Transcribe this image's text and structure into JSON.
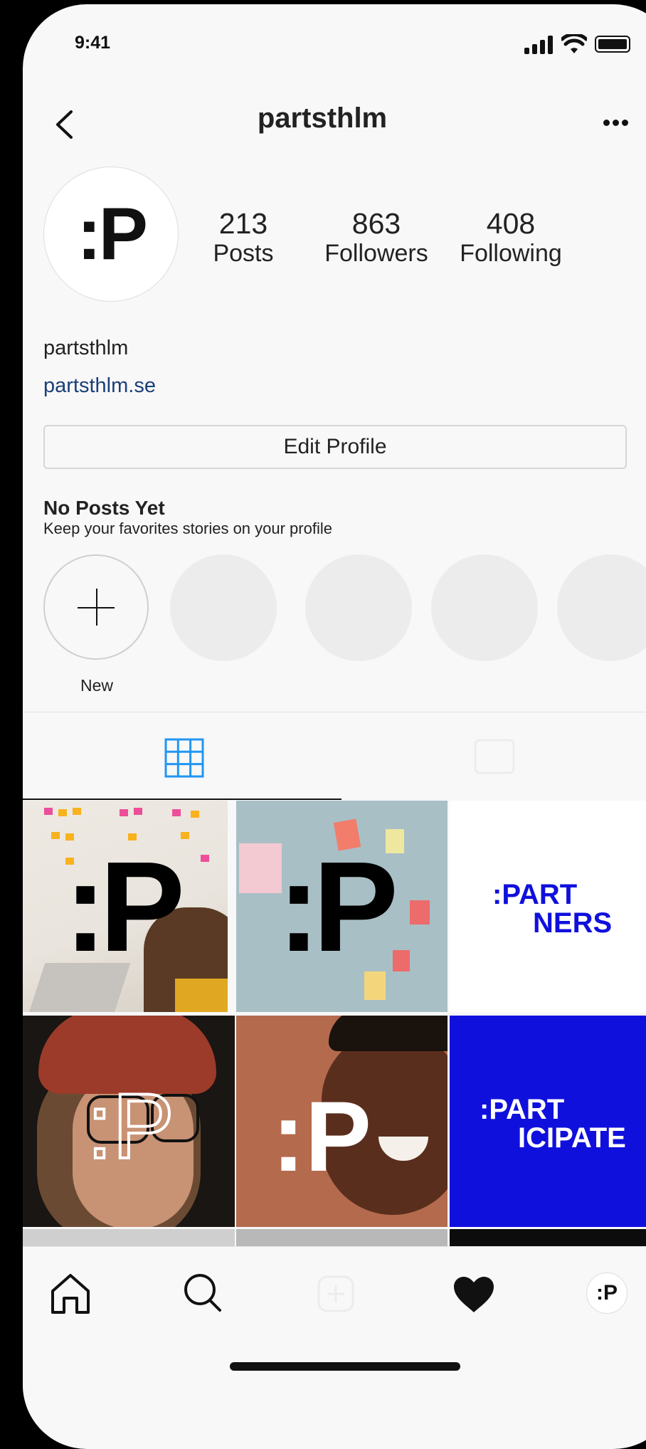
{
  "status": {
    "time": "9:41"
  },
  "header": {
    "username": "partsthlm"
  },
  "profile": {
    "avatar_text": ":P",
    "stats": [
      {
        "number": "213",
        "label": "Posts"
      },
      {
        "number": "863",
        "label": "Followers"
      },
      {
        "number": "408",
        "label": "Following"
      }
    ],
    "name": "partsthlm",
    "website": "partsthlm.se",
    "edit_label": "Edit Profile"
  },
  "highlights": {
    "title": "No Posts Yet",
    "subtitle": "Keep your favorites stories on your profile",
    "new_label": "New"
  },
  "posts": {
    "tile3_line1": ":PART",
    "tile3_line2": "NERS",
    "tile6_line1": ":PART",
    "tile6_line2": "ICIPATE",
    "logo_text": ":P"
  },
  "bottom_nav": {
    "avatar_text": ":P"
  },
  "colors": {
    "link": "#1b3f7a",
    "tab_active": "#2196f3",
    "brand_blue": "#1010dd"
  }
}
